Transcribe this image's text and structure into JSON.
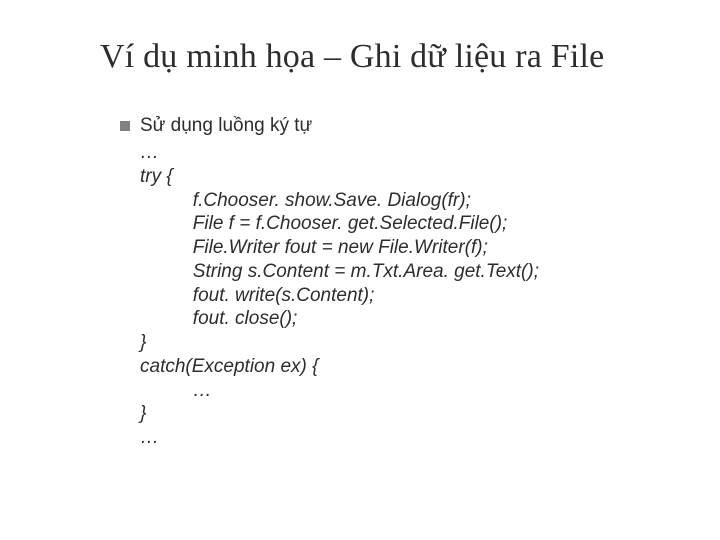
{
  "title": "Ví dụ minh họa – Ghi dữ liệu ra File",
  "bullet": "Sử dụng luồng ký tự",
  "code": {
    "l1": "…",
    "l2": "try {",
    "l3": "          f.Chooser. show.Save. Dialog(fr);",
    "l4": "          File f = f.Chooser. get.Selected.File();",
    "l5": "          File.Writer fout = new File.Writer(f);",
    "l6": "          String s.Content = m.Txt.Area. get.Text();",
    "l7": "          fout. write(s.Content);",
    "l8": "          fout. close();",
    "l9": "}",
    "l10": "catch(Exception ex) {",
    "l11": "          …",
    "l12": "}",
    "l13": "…"
  }
}
